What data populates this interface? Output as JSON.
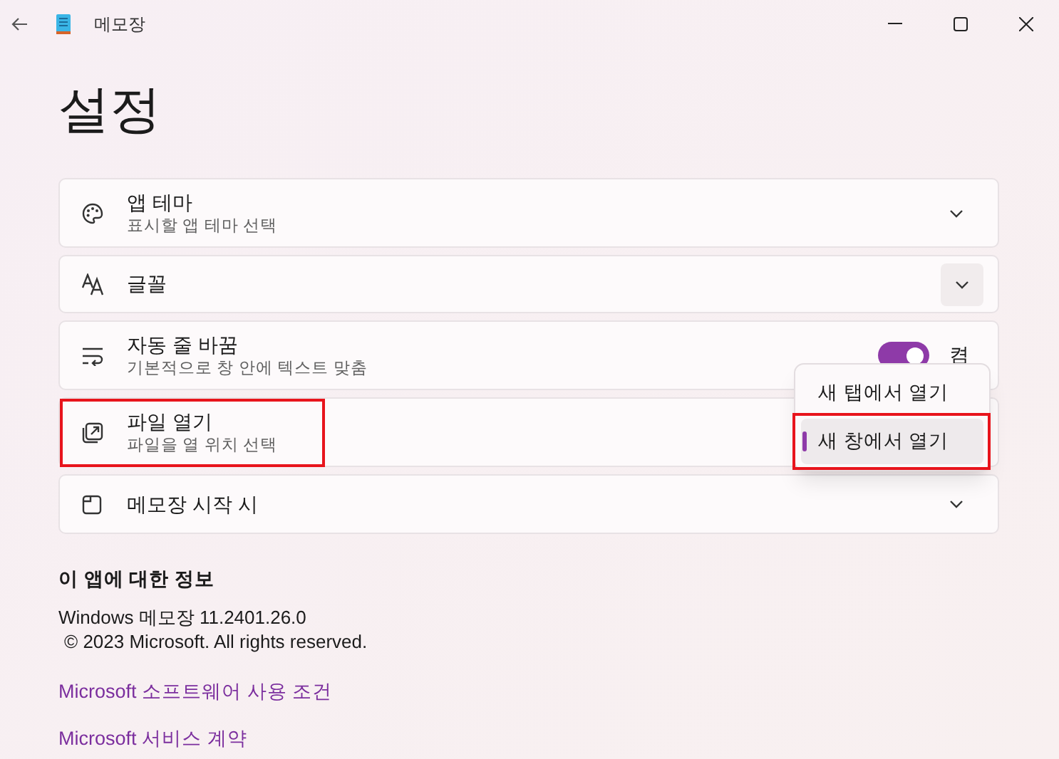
{
  "window": {
    "title": "메모장"
  },
  "heading": "설정",
  "settings": [
    {
      "kind": "dropdown",
      "title": "앱 테마",
      "subtitle": "표시할 앱 테마 선택",
      "highlighted": false
    },
    {
      "kind": "dropdown_button",
      "title": "글꼴",
      "highlighted": false
    },
    {
      "kind": "toggle",
      "title": "자동 줄 바꿈",
      "subtitle": "기본적으로 창 안에 텍스트 맞춤",
      "on": true,
      "state_label": "켬",
      "highlighted": false
    },
    {
      "kind": "menu",
      "title": "파일 열기",
      "subtitle": "파일을 열 위치 선택",
      "highlighted": true,
      "menu": [
        {
          "label": "새 탭에서 열기",
          "selected": false,
          "highlighted": false
        },
        {
          "label": "새 창에서 열기",
          "selected": true,
          "highlighted": true
        }
      ]
    },
    {
      "kind": "dropdown",
      "title": "메모장 시작 시",
      "highlighted": false
    }
  ],
  "about": {
    "heading": "이 앱에 대한 정보",
    "lines": [
      "Windows 메모장 11.2401.26.0",
      "© 2023 Microsoft. All rights reserved."
    ],
    "links": [
      "Microsoft 소프트웨어 사용 조건",
      "Microsoft 서비스 계약"
    ]
  }
}
